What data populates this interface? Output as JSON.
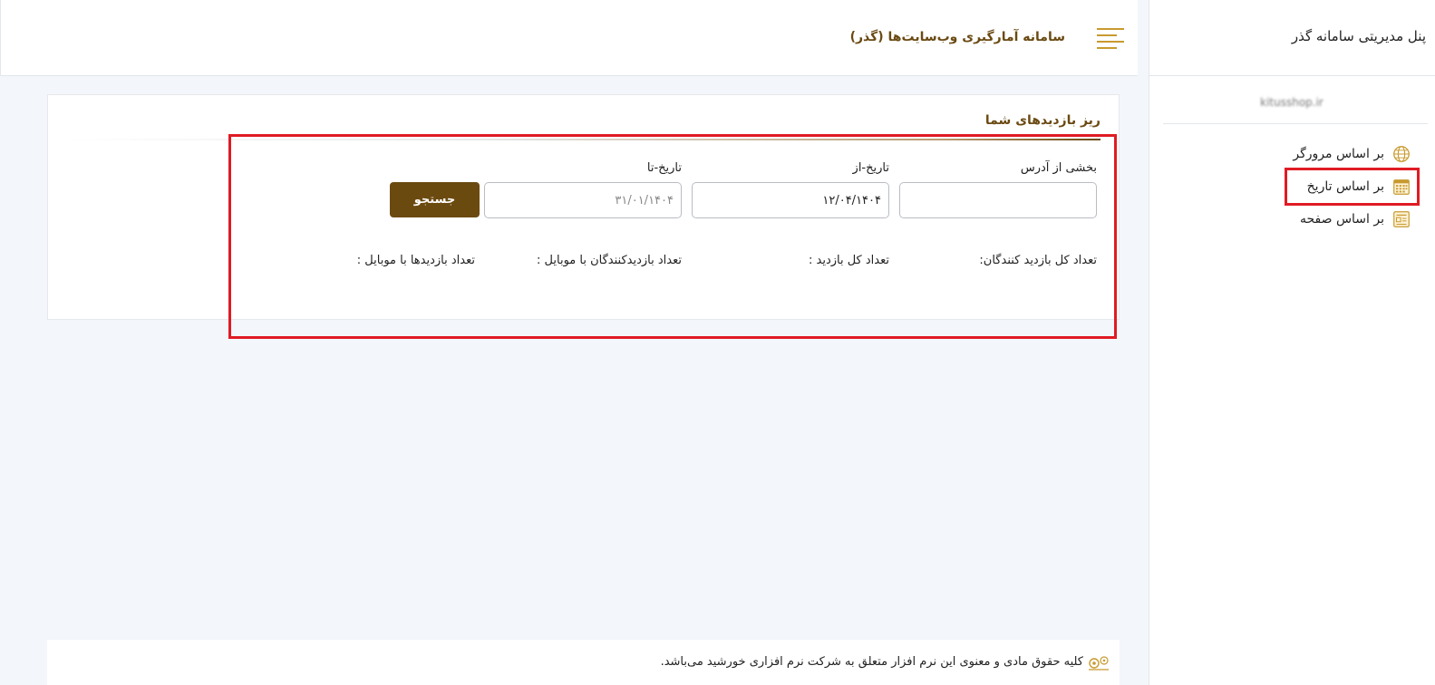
{
  "sidebar": {
    "panel_title": "پنل مدیریتی سامانه گذر",
    "site_name": "kitusshop.ir",
    "menu": [
      {
        "label": "بر اساس مرورگر",
        "icon": "globe-icon"
      },
      {
        "label": "بر اساس تاریخ",
        "icon": "calendar-icon",
        "selected": true
      },
      {
        "label": "بر اساس صفحه",
        "icon": "page-icon"
      }
    ]
  },
  "header": {
    "app_title": "سامانه آمارگیری وب‌سایت‌ها (گذر)",
    "menu_icon": "hamburger-icon"
  },
  "card": {
    "title": "ریز بازدیدهای شما",
    "fields": {
      "address_label": "بخشی از آدرس",
      "address_value": "",
      "date_from_label": "تاریخ-از",
      "date_from_value": "۱۲/۰۴/۱۴۰۴",
      "date_to_label": "تاریخ-تا",
      "date_to_placeholder": "۳۱/۰۱/۱۴۰۴"
    },
    "search_label": "جستجو",
    "stats": {
      "total_visitors": "تعداد کل بازدید کنندگان:",
      "total_visits": "تعداد کل بازدید :",
      "mobile_visitors": "تعداد بازدیدکنندگان با موبایل :",
      "mobile_visits": "تعداد بازدیدها با موبایل :"
    }
  },
  "footer": {
    "text": "کلیه حقوق مادی و معنوی این نرم افزار متعلق به شرکت نرم افزاری خورشید می‌باشد.",
    "icon": "company-logo-icon"
  },
  "colors": {
    "accent": "#6b4a10",
    "highlight": "#e01b24",
    "icon_gold": "#c89a2f"
  }
}
